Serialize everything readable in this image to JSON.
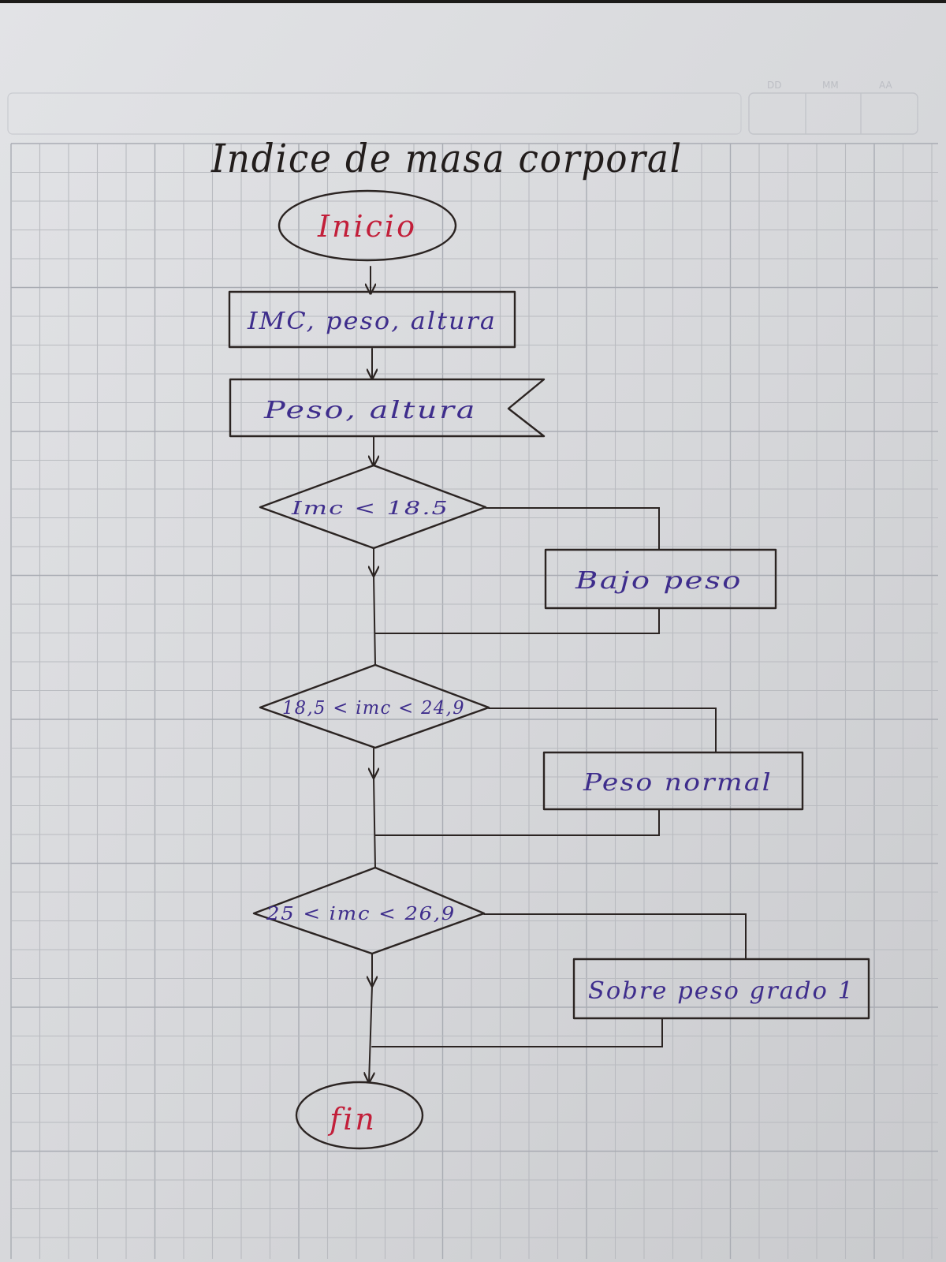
{
  "title": "Indice de masa corporal",
  "start": "Inicio",
  "declare": "IMC, peso, altura",
  "input": "Peso, altura",
  "decisions": [
    "Imc < 18.5",
    "18,5 < imc < 24,9",
    "25 < imc < 26,9"
  ],
  "results": [
    "Bajo peso",
    "Peso normal",
    "Sobre peso grado 1"
  ],
  "end": "fin",
  "date_header": {
    "day": "DD",
    "month": "MM",
    "year": "AA"
  },
  "colors": {
    "paper": "#d9dadd",
    "grid": "#b9bbc0",
    "ink": "#2b2422",
    "red_ink": "#c21f3a",
    "purple_ink": "#3e2d8c"
  }
}
